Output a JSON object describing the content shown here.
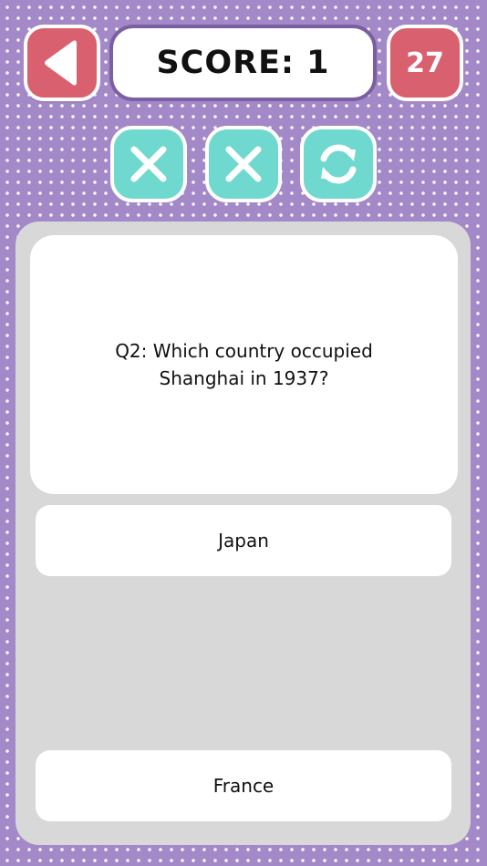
{
  "header": {
    "score_label": "SCORE:",
    "score_value": "1",
    "timer": "27"
  },
  "icons": {
    "back": "back-arrow-icon",
    "powerups": [
      "remove-answer-icon",
      "remove-answer-icon",
      "swap-question-icon"
    ]
  },
  "question": {
    "text": "Q2: Which country occupied Shanghai in 1937?"
  },
  "answers": [
    {
      "label": "Japan"
    },
    {
      "label": "France"
    }
  ],
  "colors": {
    "background": "#a389c8",
    "accent_red": "#d9606e",
    "accent_teal": "#6fd9cf",
    "score_border": "#7a5fa3",
    "panel_gray": "#d8d8d8"
  }
}
